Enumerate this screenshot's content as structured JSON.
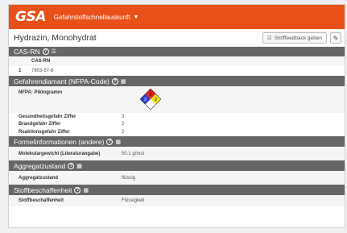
{
  "app": {
    "logo": "GSA",
    "name": "Gefahrstoffschnellauskunft",
    "menu_caret": "▼"
  },
  "page": {
    "title": "Hydrazin, Monohydrat"
  },
  "toolbar": {
    "feedback_label": "Stofffeedback geben",
    "feedback_icon": "check-square-icon",
    "edit_icon": "pencil-icon"
  },
  "sections": {
    "cas": {
      "title": "CAS-RN",
      "column_header": "CAS-RN",
      "rows": [
        {
          "index": "1",
          "value": "7803-57-8"
        }
      ]
    },
    "nfpa": {
      "title": "Gefahrendiamant (NFPA-Code)",
      "pictogram_label": "NFPA: Piktogramm",
      "diamond": {
        "flammability": "2",
        "health": "3",
        "reactivity": "2",
        "special": ""
      },
      "colors": {
        "flammability": "#e8201a",
        "health": "#2a3fd1",
        "reactivity": "#f5e11a",
        "special": "#ffffff"
      },
      "rows": [
        {
          "label": "Gesundheitsgefahr Ziffer",
          "value": "3"
        },
        {
          "label": "Brandgefahr Ziffer",
          "value": "2"
        },
        {
          "label": "Reaktionsgefahr Ziffer",
          "value": "2"
        }
      ]
    },
    "formula": {
      "title": "Formelinformationen (andere)",
      "rows": [
        {
          "label": "Molekulargewicht (Literaturangabe)",
          "value": "50.1 g/mol"
        }
      ]
    },
    "state": {
      "title": "Aggregatzustand",
      "rows": [
        {
          "label": "Aggregatzustand",
          "value": "flüssig"
        }
      ]
    },
    "nature": {
      "title": "Stoffbeschaffenheit",
      "rows": [
        {
          "label": "Stoffbeschaffenheit",
          "value": "Flüssigkeit"
        }
      ]
    }
  },
  "colors": {
    "brand": "#e8501a",
    "section_header": "#666666"
  }
}
